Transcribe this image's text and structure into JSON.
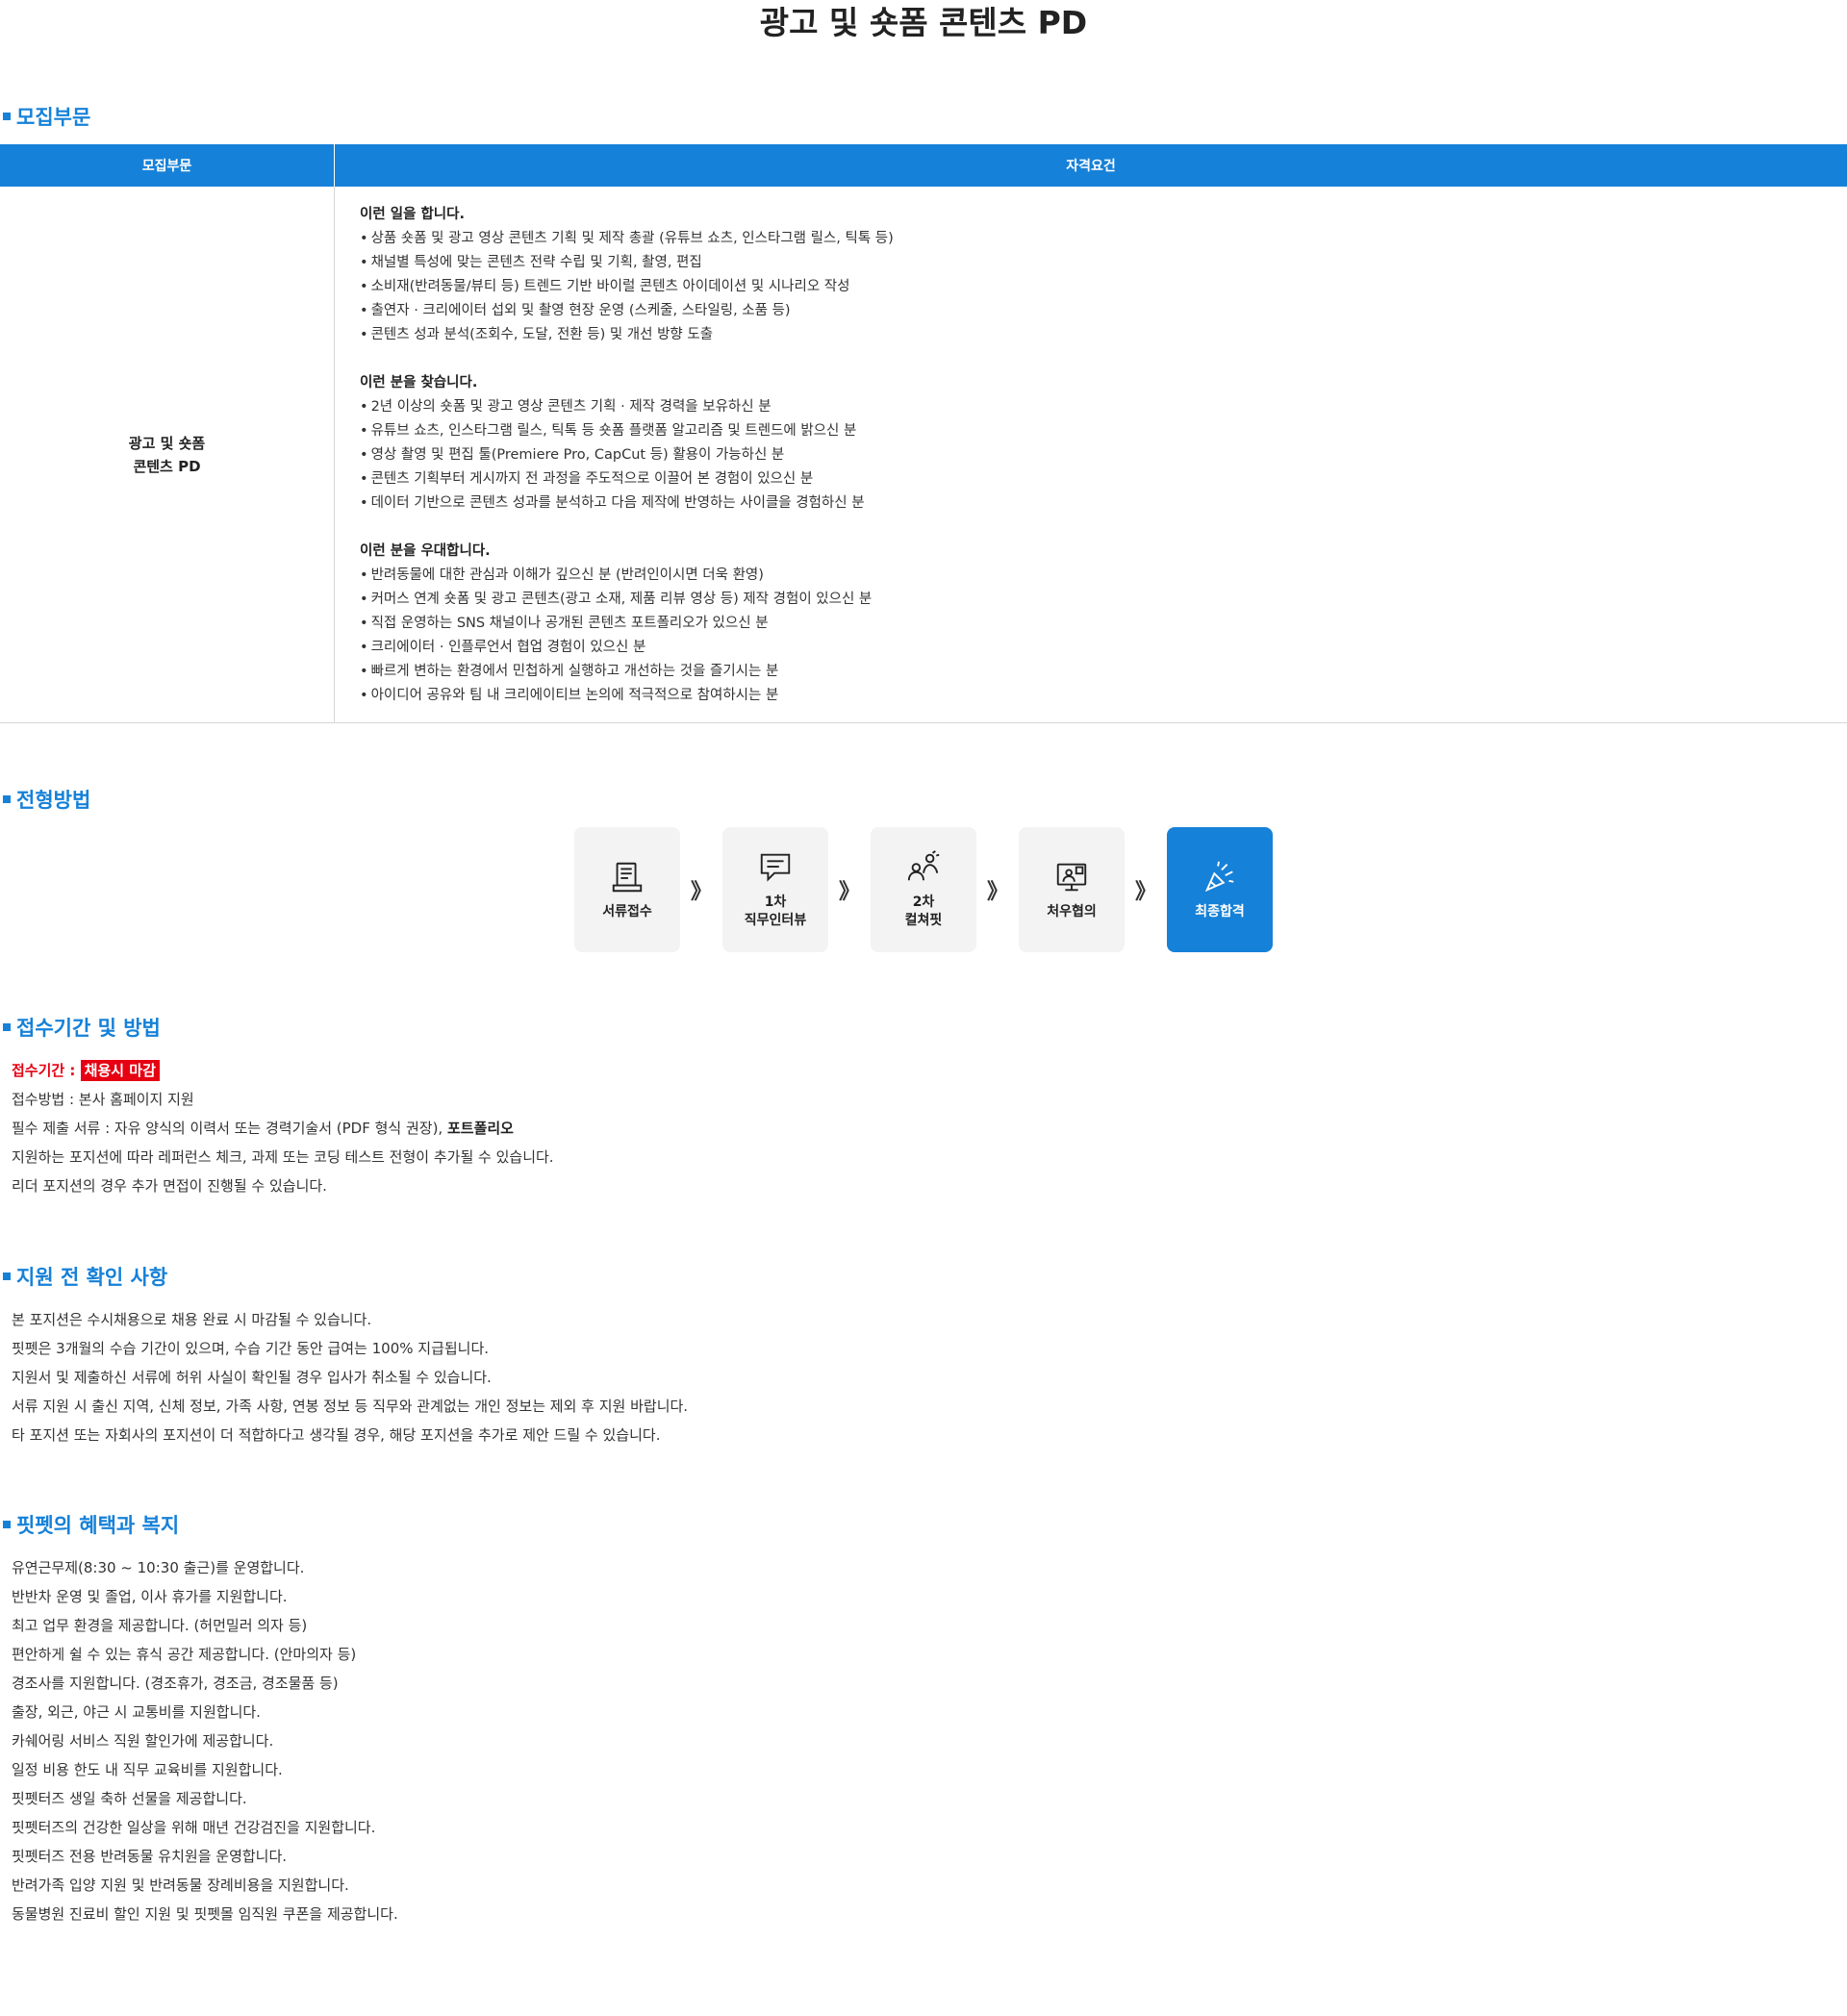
{
  "page_title": "광고 및 숏폼 콘텐츠 PD",
  "sections": {
    "recruit": "모집부문",
    "process": "전형방법",
    "apply": "접수기간 및 방법",
    "notice": "지원 전 확인 사항",
    "benefits": "핏펫의 혜택과 복지"
  },
  "table": {
    "header_position": "모집부문",
    "header_requirements": "자격요건",
    "position_line1": "광고 및 숏폼",
    "position_line2": "콘텐츠 PD",
    "groups": [
      {
        "title": "이런 일을 합니다.",
        "items": [
          "상품 숏폼 및 광고 영상 콘텐츠 기획 및 제작 총괄 (유튜브 쇼츠, 인스타그램 릴스, 틱톡 등)",
          "채널별 특성에 맞는 콘텐츠 전략 수립 및 기획, 촬영, 편집",
          "소비재(반려동물/뷰티 등) 트렌드 기반 바이럴 콘텐츠 아이데이션 및 시나리오 작성",
          "출연자 · 크리에이터 섭외 및 촬영 현장 운영 (스케줄, 스타일링, 소품 등)",
          "콘텐츠 성과 분석(조회수, 도달, 전환 등) 및 개선 방향 도출"
        ]
      },
      {
        "title": "이런 분을 찾습니다.",
        "items": [
          "2년 이상의 숏폼 및 광고 영상 콘텐츠 기획 · 제작 경력을 보유하신 분",
          "유튜브 쇼츠, 인스타그램 릴스, 틱톡 등 숏폼 플랫폼 알고리즘 및 트렌드에 밝으신 분",
          "영상 촬영 및 편집 툴(Premiere Pro, CapCut 등) 활용이 가능하신 분",
          "콘텐츠 기획부터 게시까지 전 과정을 주도적으로 이끌어 본 경험이 있으신 분",
          "데이터 기반으로 콘텐츠 성과를 분석하고 다음 제작에 반영하는 사이클을 경험하신 분"
        ]
      },
      {
        "title": "이런 분을 우대합니다.",
        "items": [
          "반려동물에 대한 관심과 이해가 깊으신 분 (반려인이시면 더욱 환영)",
          "커머스 연계 숏폼 및 광고 콘텐츠(광고 소재, 제품 리뷰 영상 등) 제작 경험이 있으신 분",
          "직접 운영하는 SNS 채널이나 공개된 콘텐츠 포트폴리오가 있으신 분",
          "크리에이터 · 인플루언서 협업 경험이 있으신 분",
          "빠르게 변하는 환경에서 민첩하게 실행하고 개선하는 것을 즐기시는 분",
          "아이디어 공유와 팀 내 크리에이티브 논의에 적극적으로 참여하시는 분"
        ]
      }
    ]
  },
  "process_steps": [
    {
      "line1": "서류접수",
      "line2": "",
      "icon": "document-icon"
    },
    {
      "line1": "1차",
      "line2": "직무인터뷰",
      "icon": "chat-icon"
    },
    {
      "line1": "2차",
      "line2": "컬쳐핏",
      "icon": "people-icon"
    },
    {
      "line1": "처우협의",
      "line2": "",
      "icon": "monitor-person-icon"
    },
    {
      "line1": "최종합격",
      "line2": "",
      "icon": "celebration-icon"
    }
  ],
  "process_arrow": "》",
  "apply": {
    "period_label": "접수기간 : ",
    "period_value": "채용시 마감",
    "method": "접수방법 : 본사 홈페이지 지원",
    "docs_prefix": "필수 제출 서류 : 자유 양식의 이력서 또는 경력기술서 (PDF 형식 권장), ",
    "docs_bold": "포트폴리오",
    "extra1": "지원하는 포지션에 따라 레퍼런스 체크, 과제 또는 코딩 테스트 전형이 추가될 수 있습니다.",
    "extra2": "리더 포지션의 경우 추가 면접이 진행될 수 있습니다."
  },
  "notice_items": [
    "본 포지션은 수시채용으로 채용 완료 시 마감될 수 있습니다.",
    "핏펫은 3개월의 수습 기간이 있으며, 수습 기간 동안 급여는 100% 지급됩니다.",
    "지원서 및 제출하신 서류에 허위 사실이 확인될 경우 입사가 취소될 수 있습니다.",
    "서류 지원 시 출신 지역, 신체 정보, 가족 사항, 연봉 정보 등 직무와 관계없는 개인 정보는 제외 후 지원 바랍니다.",
    "타 포지션 또는 자회사의 포지션이 더 적합하다고 생각될 경우, 해당 포지션을 추가로 제안 드릴 수 있습니다."
  ],
  "benefit_items": [
    "유연근무제(8:30 ~ 10:30 출근)를 운영합니다.",
    "반반차 운영 및 졸업, 이사 휴가를 지원합니다.",
    "최고 업무 환경을 제공합니다. (허먼밀러 의자 등)",
    "편안하게 쉴 수 있는 휴식 공간 제공합니다. (안마의자 등)",
    "경조사를 지원합니다. (경조휴가, 경조금, 경조물품 등)",
    "출장, 외근, 야근 시 교통비를 지원합니다.",
    "카쉐어링 서비스 직원 할인가에 제공합니다.",
    "일정 비용 한도 내 직무 교육비를 지원합니다.",
    "핏펫터즈 생일 축하 선물을 제공합니다.",
    "핏펫터즈의 건강한 일상을 위해 매년 건강검진을 지원합니다.",
    "핏펫터즈 전용 반려동물 유치원을 운영합니다.",
    "반려가족 입양 지원 및 반려동물 장례비용을 지원합니다.",
    "동물병원 진료비 할인 지원 및 핏펫몰 임직원 쿠폰을 제공합니다."
  ],
  "colors": {
    "accent": "#1681d8",
    "highlight": "#e60012",
    "step_bg": "#f3f3f3"
  }
}
